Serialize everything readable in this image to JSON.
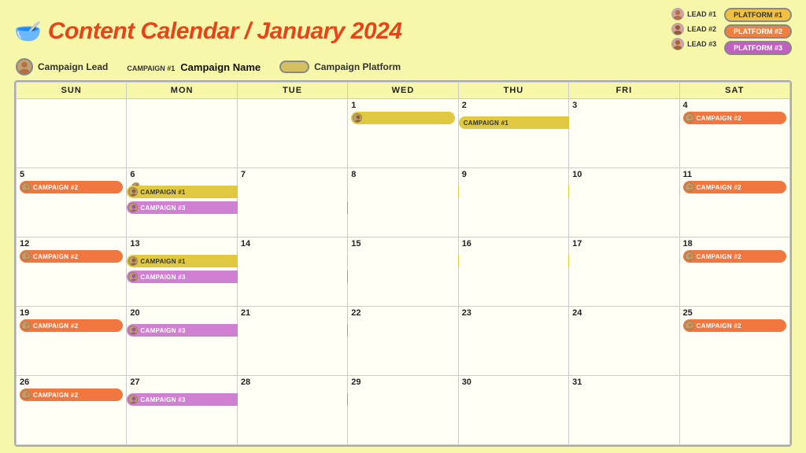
{
  "header": {
    "title": "Content Calendar / January 2024",
    "icon": "🥣"
  },
  "legend": {
    "leads": [
      {
        "label": "LEAD #1"
      },
      {
        "label": "LEAD #2"
      },
      {
        "label": "LEAD #3"
      }
    ],
    "platforms": [
      {
        "label": "PLATFORM #1",
        "class": "platform-1"
      },
      {
        "label": "PLATFORM #2",
        "class": "platform-2"
      },
      {
        "label": "PLATFORM #3",
        "class": "platform-3"
      }
    ]
  },
  "sub_legend": {
    "campaign_lead": "Campaign Lead",
    "campaign_num": "CAMPAIGN #1",
    "campaign_name": "Campaign Name",
    "campaign_platform": "Campaign Platform"
  },
  "days_of_week": [
    "SUN",
    "MON",
    "TUE",
    "WED",
    "THU",
    "FRI",
    "SAT"
  ],
  "weeks": [
    {
      "days": [
        {
          "num": "",
          "events": []
        },
        {
          "num": "",
          "events": []
        },
        {
          "num": "",
          "events": []
        },
        {
          "num": "1",
          "events": [
            {
              "type": "campaign1",
              "label": "",
              "avatar": true
            }
          ]
        },
        {
          "num": "2",
          "events": [
            {
              "type": "campaign1_cont",
              "label": "CAMPAIGN #1"
            }
          ]
        },
        {
          "num": "3",
          "events": []
        },
        {
          "num": "4",
          "events": [
            {
              "type": "campaign2",
              "label": "CAMPAIGN #2",
              "avatar": true
            }
          ]
        }
      ]
    },
    {
      "days": [
        {
          "num": "5",
          "events": [
            {
              "type": "campaign2",
              "label": "CAMPAIGN #2",
              "avatar": true
            }
          ]
        },
        {
          "num": "6",
          "events": [
            {
              "type": "campaign1_start",
              "avatar": true
            },
            {
              "type": "campaign3_start",
              "avatar": true
            }
          ]
        },
        {
          "num": "7",
          "events": []
        },
        {
          "num": "8",
          "events": []
        },
        {
          "num": "9",
          "events": []
        },
        {
          "num": "10",
          "events": []
        },
        {
          "num": "11",
          "events": [
            {
              "type": "campaign2",
              "label": "CAMPAIGN #2",
              "avatar": true
            }
          ]
        }
      ]
    },
    {
      "days": [
        {
          "num": "12",
          "events": [
            {
              "type": "campaign2",
              "label": "CAMPAIGN #2",
              "avatar": true
            }
          ]
        },
        {
          "num": "13",
          "events": [
            {
              "type": "campaign1_start",
              "avatar": true
            },
            {
              "type": "campaign3_start",
              "avatar": true
            }
          ]
        },
        {
          "num": "14",
          "events": []
        },
        {
          "num": "15",
          "events": []
        },
        {
          "num": "16",
          "events": []
        },
        {
          "num": "17",
          "events": []
        },
        {
          "num": "18",
          "events": [
            {
              "type": "campaign2",
              "label": "CAMPAIGN #2",
              "avatar": true
            }
          ]
        }
      ]
    },
    {
      "days": [
        {
          "num": "19",
          "events": [
            {
              "type": "campaign2",
              "label": "CAMPAIGN #2",
              "avatar": true
            }
          ]
        },
        {
          "num": "20",
          "events": [
            {
              "type": "campaign3_start2",
              "avatar": true
            }
          ]
        },
        {
          "num": "21",
          "events": []
        },
        {
          "num": "22",
          "events": []
        },
        {
          "num": "23",
          "events": []
        },
        {
          "num": "24",
          "events": []
        },
        {
          "num": "25",
          "events": [
            {
              "type": "campaign2",
              "label": "CAMPAIGN #2",
              "avatar": true
            }
          ]
        }
      ]
    },
    {
      "days": [
        {
          "num": "26",
          "events": [
            {
              "type": "campaign2",
              "label": "CAMPAIGN #2",
              "avatar": true
            }
          ]
        },
        {
          "num": "27",
          "events": [
            {
              "type": "campaign3_start3",
              "avatar": true
            }
          ]
        },
        {
          "num": "28",
          "events": []
        },
        {
          "num": "29",
          "events": []
        },
        {
          "num": "30",
          "events": []
        },
        {
          "num": "31",
          "events": []
        },
        {
          "num": "",
          "events": []
        }
      ]
    }
  ]
}
